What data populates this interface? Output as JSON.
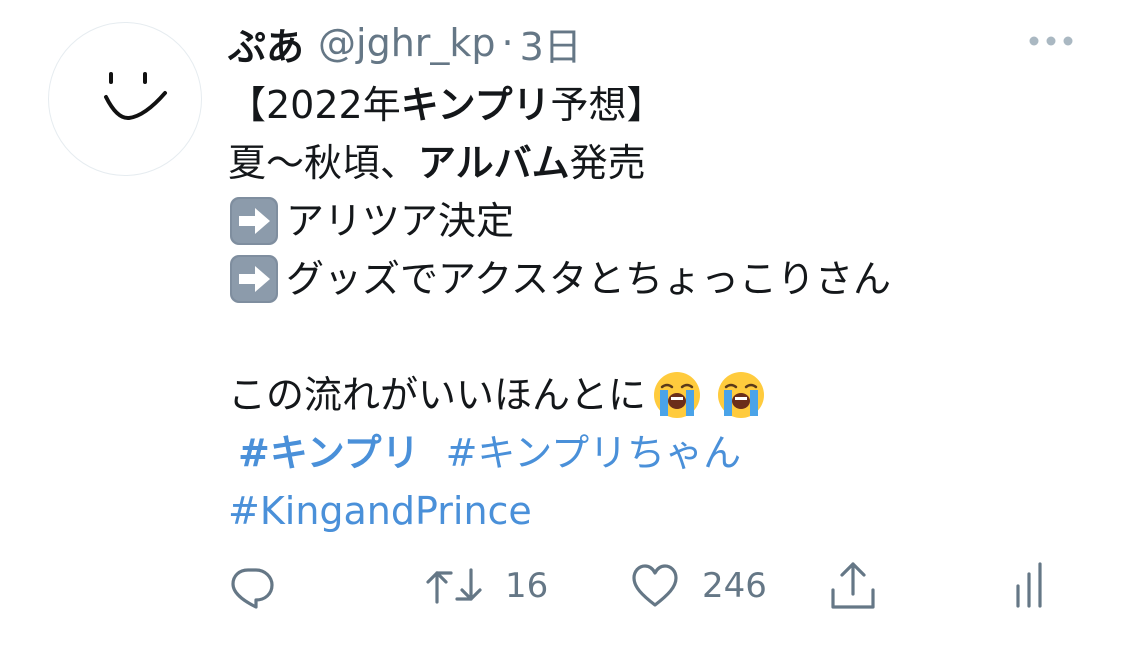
{
  "tweet": {
    "display_name": "ぷあ",
    "handle": "@jghr_kp",
    "separator": "·",
    "time": "3日",
    "lines": {
      "l1_a": "【2022年 ",
      "l1_b": "キンプリ",
      "l1_c": "予想】",
      "l2_a": "夏〜秋頃、",
      "l2_b": "アルバム",
      "l2_c": "発売",
      "l3": "アリツア決定",
      "l4": "グッズでアクスタとちょっこりさん",
      "l5": "この流れがいいほんとに"
    },
    "hashtags": [
      "#キンプリ",
      "#キンプリちゃん",
      "#KingandPrince"
    ]
  },
  "actions": {
    "retweet_count": "16",
    "like_count": "246"
  },
  "icons": {
    "avatar": "smiley-face-avatar",
    "more": "more-dots-icon",
    "arrow": "right-arrow-emoji",
    "cry": "loudly-crying-face-emoji",
    "reply": "reply-icon",
    "retweet": "retweet-icon",
    "like": "heart-icon",
    "share": "share-icon",
    "analytics": "analytics-icon"
  },
  "colors": {
    "text": "#14171a",
    "secondary": "#657786",
    "link": "#4a90d9"
  }
}
